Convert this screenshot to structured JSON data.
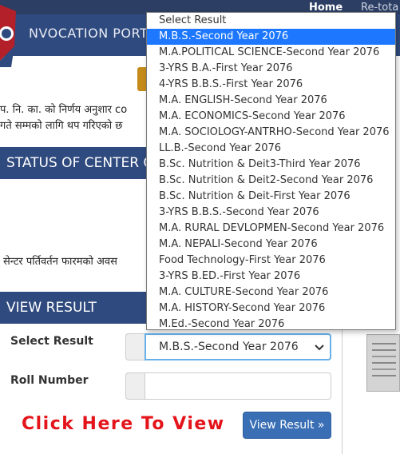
{
  "nav": {
    "home": "Home",
    "retotal": "Re-tota"
  },
  "header": {
    "title": "NVOCATION PORT"
  },
  "notice": {
    "line1": "प. नि. का. को निर्णय अनुशार co",
    "line2": "गते सम्मको लागि थप गरिएको छ"
  },
  "status_bar": {
    "title": "STATUS OF CENTER C"
  },
  "center_note": "सेन्टर पर्तिवर्तन फारमको अवस",
  "view_result": {
    "title": "VIEW RESULT",
    "select_label": "Select Result",
    "select_value": "M.B.S.-Second Year 2076",
    "roll_label": "Roll Number",
    "roll_value": "",
    "click_text": "Click Here To View",
    "button_label": "View Result »"
  },
  "dropdown": {
    "selected_index": 1,
    "options": [
      "Select Result",
      "M.B.S.-Second Year 2076",
      "M.A.POLITICAL SCIENCE-Second Year 2076",
      "3-YRS B.A.-First Year 2076",
      "4-YRS B.B.S.-First Year 2076",
      "M.A. ENGLISH-Second Year 2076",
      "M.A. ECONOMICS-Second Year 2076",
      "M.A. SOCIOLOGY-ANTRHO-Second Year 2076",
      "LL.B.-Second Year 2076",
      "B.Sc. Nutrition & Deit3-Third Year 2076",
      "B.Sc. Nutrition & Deit2-Second Year 2076",
      "B.Sc. Nutrition & Deit-First Year 2076",
      "3-YRS B.B.S.-Second Year 2076",
      "M.A. RURAL DEVLOPMEN-Second Year 2076",
      "M.A. NEPALI-Second Year 2076",
      "Food Technology-First Year 2076",
      "3-YRS B.ED.-First Year 2076",
      "M.A. CULTURE-Second Year 2076",
      "M.A. HISTORY-Second Year 2076",
      "M.Ed.-Second Year 2076"
    ]
  },
  "colors": {
    "header": "#2f4a7e",
    "selected": "#1e78ff",
    "click_text": "#e4141b",
    "button": "#3a6fb5"
  }
}
